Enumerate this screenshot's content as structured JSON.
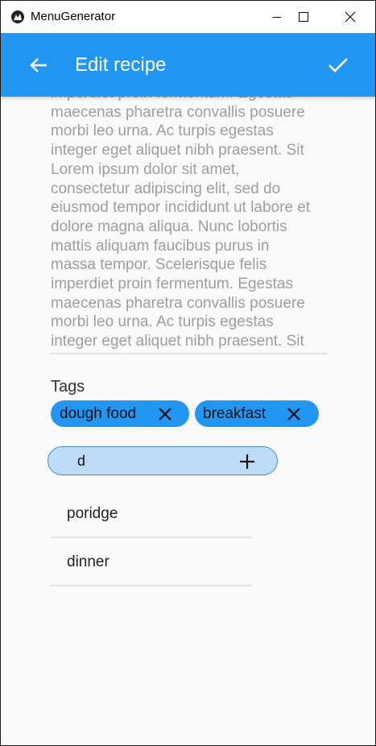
{
  "window": {
    "title": "MenuGenerator"
  },
  "appbar": {
    "title": "Edit recipe",
    "background": "#2196f3"
  },
  "description": {
    "text": "imperdiet proin fermentum. Egestas\nmaecenas pharetra convallis posuere\nmorbi leo urna. Ac turpis egestas\ninteger eget aliquet nibh praesent. Sit\nLorem ipsum dolor sit amet,\nconsectetur adipiscing elit, sed do\neiusmod tempor incididunt ut labore et\n dolore magna aliqua. Nunc lobortis\nmattis aliquam faucibus purus in\nmassa tempor. Scelerisque felis\nimperdiet proin fermentum. Egestas\nmaecenas pharetra convallis posuere\nmorbi leo urna. Ac turpis egestas\ninteger eget aliquet nibh praesent. Sit"
  },
  "tags": {
    "label": "Tags",
    "chips": [
      {
        "label": "dough food"
      },
      {
        "label": "breakfast"
      }
    ],
    "input_value": "d"
  },
  "suggestions": [
    {
      "label": "poridge"
    },
    {
      "label": "dinner"
    }
  ],
  "icons": {
    "app": "kivy-logo-icon",
    "minimize": "minimize-icon",
    "maximize": "maximize-icon",
    "close": "close-icon",
    "back": "arrow-left-icon",
    "confirm": "check-icon",
    "chip_remove": "close-icon",
    "add": "plus-icon"
  }
}
